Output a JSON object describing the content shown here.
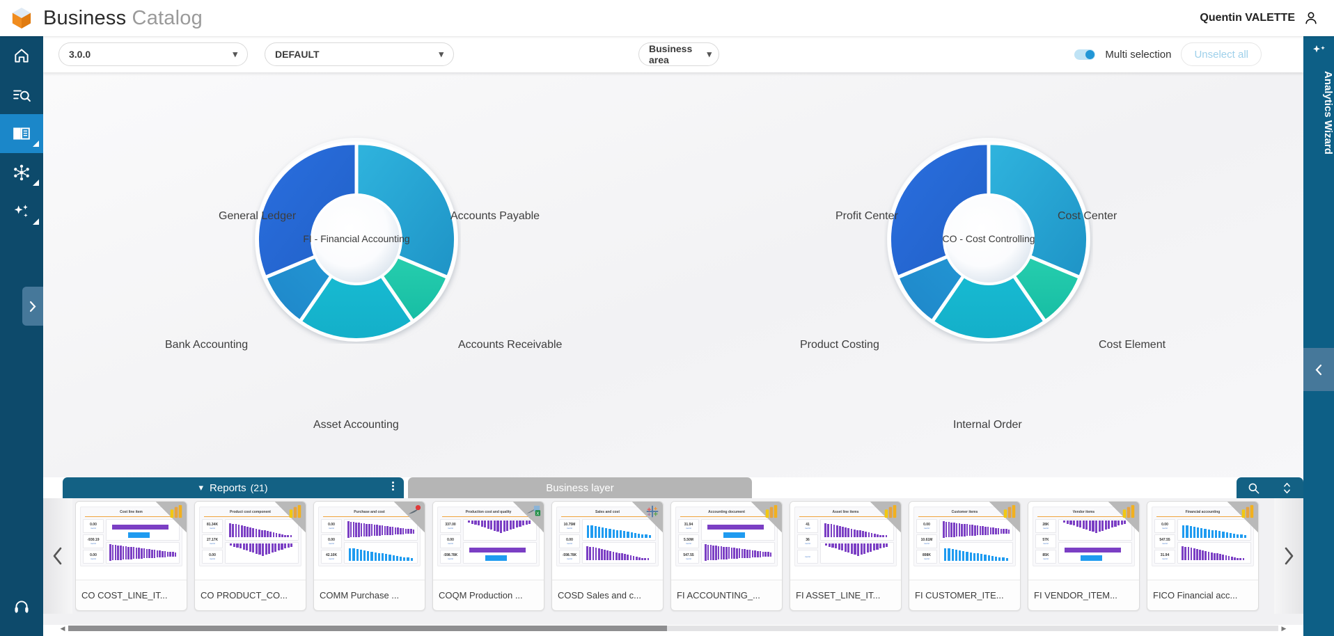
{
  "header": {
    "title_bold": "Business",
    "title_dim": "Catalog",
    "logo_icon": "cube-icon",
    "user_name": "Quentin VALETTE",
    "user_icon": "user-icon"
  },
  "sidebar": {
    "items": [
      {
        "id": "home",
        "icon": "home-icon",
        "label": "Home",
        "active": false,
        "has_corner": false
      },
      {
        "id": "search",
        "icon": "search-list-icon",
        "label": "Search",
        "active": false,
        "has_corner": false
      },
      {
        "id": "catalog",
        "icon": "book-icon",
        "label": "Catalog",
        "active": true,
        "has_corner": true
      },
      {
        "id": "network",
        "icon": "network-icon",
        "label": "Network",
        "active": false,
        "has_corner": true
      },
      {
        "id": "ai",
        "icon": "sparkle-icon",
        "label": "AI",
        "active": false,
        "has_corner": true
      }
    ],
    "bottom_icon": "lifebuoy-icon",
    "expand_icon": "chevron-right-icon"
  },
  "right_rail": {
    "label": "Analytics Wizard",
    "sparkle_icon": "sparkle-icon",
    "collapse_icon": "chevron-left-icon"
  },
  "filter_bar": {
    "version_select": {
      "value": "3.0.0",
      "icon": "chevron-down-icon"
    },
    "default_select": {
      "value": "DEFAULT",
      "icon": "chevron-down-icon"
    },
    "area_select": {
      "value": "Business area",
      "icon": "chevron-down-icon"
    },
    "multi_selection_label": "Multi selection",
    "multi_selection_on": true,
    "unselect_all_label": "Unselect all"
  },
  "chart_data": [
    {
      "type": "pie",
      "id": "fi-donut",
      "title": "FI - Financial Accounting",
      "center_label": "FI - Financial Accounting",
      "categories": [
        "Accounts Payable",
        "Accounts Receivable",
        "Asset Accounting",
        "Bank Accounting",
        "General Ledger"
      ],
      "values": [
        20,
        20,
        20,
        20,
        20
      ],
      "colors": [
        "#28a6d8",
        "#1fc3a8",
        "#17bdd4",
        "#2090cf",
        "#2367cf"
      ],
      "legend": "around-slices",
      "labels": [
        {
          "text": "General Ledger",
          "position": "top-left"
        },
        {
          "text": "Accounts Payable",
          "position": "top-right"
        },
        {
          "text": "Accounts Receivable",
          "position": "right"
        },
        {
          "text": "Asset Accounting",
          "position": "bottom"
        },
        {
          "text": "Bank Accounting",
          "position": "left"
        }
      ]
    },
    {
      "type": "pie",
      "id": "co-donut",
      "title": "CO - Cost Controlling",
      "center_label": "CO - Cost Controlling",
      "categories": [
        "Cost Center",
        "Cost Element",
        "Internal Order",
        "Product Costing",
        "Profit Center"
      ],
      "values": [
        20,
        20,
        20,
        20,
        20
      ],
      "colors": [
        "#28a6d8",
        "#1fc3a8",
        "#17bdd4",
        "#2090cf",
        "#2367cf"
      ],
      "legend": "around-slices",
      "labels": [
        {
          "text": "Profit Center",
          "position": "top-left"
        },
        {
          "text": "Cost Center",
          "position": "top-right"
        },
        {
          "text": "Cost Element",
          "position": "right"
        },
        {
          "text": "Internal Order",
          "position": "bottom"
        },
        {
          "text": "Product Costing",
          "position": "left"
        }
      ]
    }
  ],
  "tabs": [
    {
      "id": "reports",
      "label": "Reports",
      "count": "(21)",
      "active": true,
      "chevron": "chevron-down-icon",
      "kebab": "kebab-icon"
    },
    {
      "id": "business-layer",
      "label": "Business layer",
      "count": "",
      "active": false
    }
  ],
  "tools": {
    "search_icon": "search-icon",
    "resize_icon": "resize-vertical-icon"
  },
  "gallery": {
    "prev_icon": "chevron-left-icon",
    "next_icon": "chevron-right-icon",
    "cards": [
      {
        "name": "CO COST_LINE_IT...",
        "thumb_title": "Cost line item",
        "badge": "powerbi-icon",
        "kpis": [
          "0.00",
          "-930.19",
          "0.00"
        ]
      },
      {
        "name": "CO PRODUCT_CO...",
        "thumb_title": "Product cost component",
        "badge": "powerbi-icon",
        "kpis": [
          "81.34K",
          "27.17K",
          "0.00"
        ]
      },
      {
        "name": "COMM Purchase ...",
        "thumb_title": "Purchase and cost",
        "badge": "qlik-icon",
        "kpis": [
          "0.00",
          "0.00",
          "42.10K"
        ]
      },
      {
        "name": "COQM Production ...",
        "thumb_title": "Production cost and quality",
        "badge": "excel-icon",
        "kpis": [
          "337.00",
          "0.00",
          "-598.78K"
        ]
      },
      {
        "name": "COSD Sales and c...",
        "thumb_title": "Sales and cost",
        "badge": "tableau-icon",
        "kpis": [
          "10.75M",
          "0.00",
          "-598.78K"
        ]
      },
      {
        "name": "FI ACCOUNTING_...",
        "thumb_title": "Accounting document",
        "badge": "powerbi-icon",
        "kpis": [
          "31.94",
          "5.50M",
          "547.55"
        ]
      },
      {
        "name": "FI ASSET_LINE_IT...",
        "thumb_title": "Asset line items",
        "badge": "powerbi-icon",
        "kpis": [
          "41",
          "36",
          ""
        ]
      },
      {
        "name": "FI CUSTOMER_ITE...",
        "thumb_title": "Customer items",
        "badge": "powerbi-icon",
        "kpis": [
          "0.00",
          "10.61M",
          "898K"
        ]
      },
      {
        "name": "FI VENDOR_ITEM...",
        "thumb_title": "Vendor items",
        "badge": "powerbi-icon",
        "kpis": [
          "28K",
          "57K",
          "85K"
        ]
      },
      {
        "name": "FICO Financial acc...",
        "thumb_title": "Financial accounting",
        "badge": "powerbi-icon",
        "kpis": [
          "0.00",
          "547.55",
          "31.94"
        ]
      }
    ]
  },
  "scrollbar": {
    "left_arrow": "triangle-left-icon",
    "right_arrow": "triangle-right-icon"
  }
}
